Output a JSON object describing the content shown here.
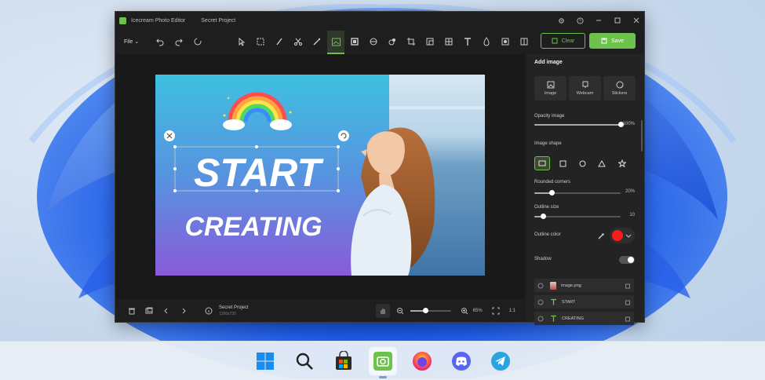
{
  "window": {
    "app_title": "Icecream Photo Editor",
    "project_title": "Secret Project"
  },
  "toolbar": {
    "file_label": "File",
    "clear_label": "Clear",
    "save_label": "Save"
  },
  "canvas": {
    "headline_1": "START",
    "headline_2": "CREATING"
  },
  "side_panel": {
    "title": "Add image",
    "add_buttons": [
      {
        "label": "Image"
      },
      {
        "label": "Webcam"
      },
      {
        "label": "Stickers"
      }
    ],
    "opacity": {
      "label": "Opacity image",
      "value_text": "100%",
      "value": 100
    },
    "shape_label": "Image shape",
    "rounded": {
      "label": "Rounded corners",
      "value_text": "20%",
      "value": 20
    },
    "outline_size": {
      "label": "Outline size",
      "value_text": "10",
      "value": 10
    },
    "outline_color": {
      "label": "Outline color",
      "color": "#ff1a1a"
    },
    "shadow_label": "Shadow"
  },
  "layers": [
    {
      "label": "image.png",
      "type": "image"
    },
    {
      "label": "START",
      "type": "text"
    },
    {
      "label": "CREATING",
      "type": "text"
    }
  ],
  "bottom": {
    "project_name": "Secret Project",
    "project_size": "1280x720",
    "zoom_text": "65%",
    "ratio_text": "1:1"
  },
  "colors": {
    "accent": "#6cc24a"
  }
}
